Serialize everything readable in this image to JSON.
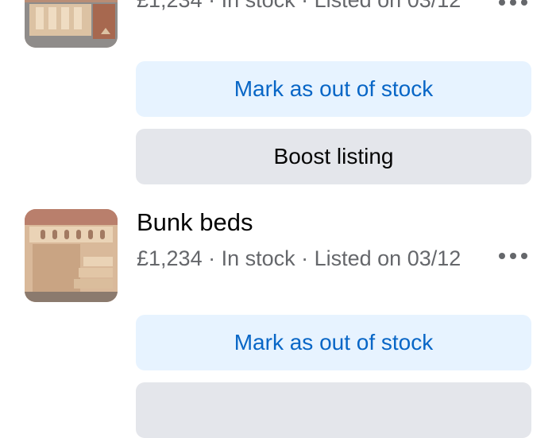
{
  "listings": [
    {
      "title": "",
      "meta": "£1,234 · In stock · Listed on 03/12",
      "thumbnail_icon": "bunk-bed-photo",
      "more_icon": "more-options-icon",
      "mark_out_of_stock_label": "Mark as out of stock",
      "boost_listing_label": "Boost listing"
    },
    {
      "title": "Bunk beds",
      "meta": "£1,234 · In stock · Listed on 03/12",
      "thumbnail_icon": "bunk-bed-photo",
      "more_icon": "more-options-icon",
      "mark_out_of_stock_label": "Mark as out of stock",
      "boost_listing_label": ""
    }
  ],
  "colors": {
    "primary_button_bg": "#e7f3ff",
    "primary_button_text": "#0866c6",
    "secondary_button_bg": "#e4e6eb",
    "meta_text": "#65676b"
  }
}
